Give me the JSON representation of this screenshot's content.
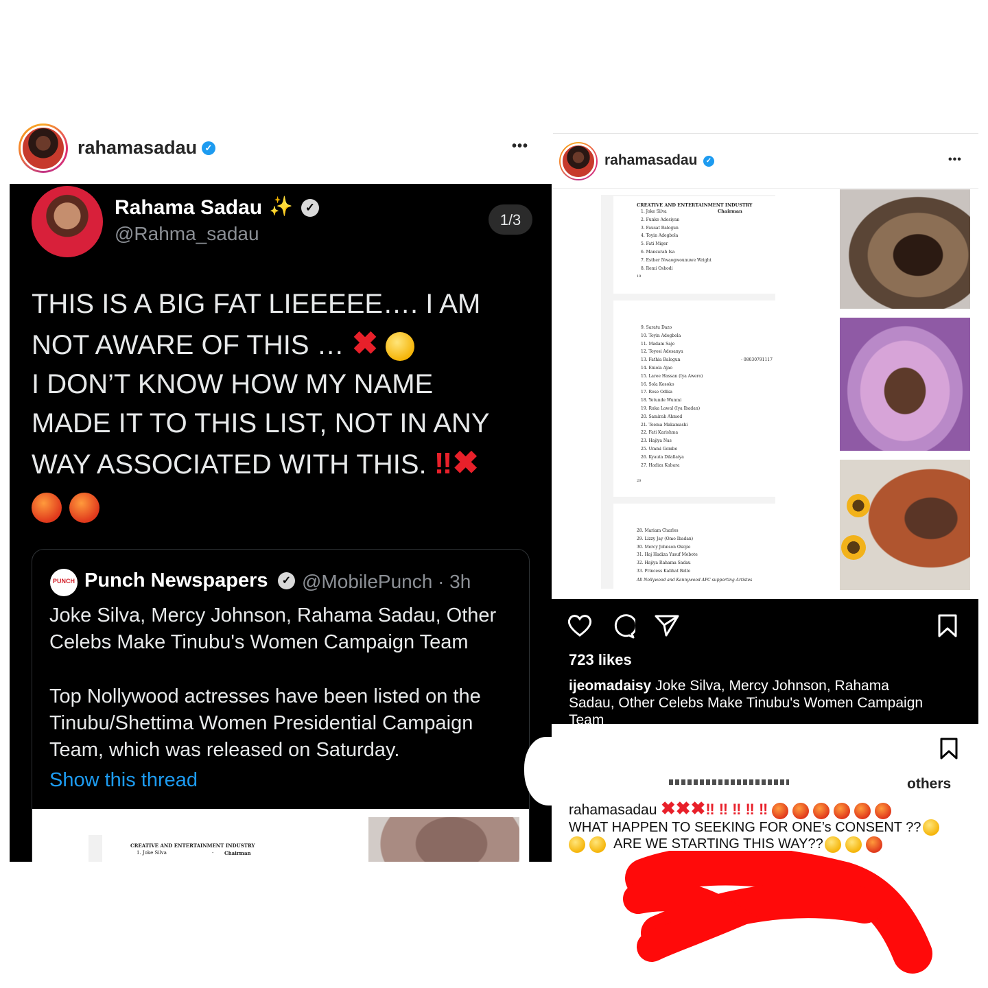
{
  "left_post": {
    "username": "rahamasadau",
    "more": "•••",
    "tweet": {
      "name": "Rahama Sadau",
      "sparkle": "✨",
      "handle": "@Rahma_sadau",
      "counter": "1/3",
      "body_lines": [
        "THIS IS A BIG FAT LIEEEEE…. I AM",
        "NOT AWARE OF THIS …",
        "I DON’T KNOW HOW MY NAME",
        "MADE IT TO THIS LIST, NOT IN ANY",
        "WAY ASSOCIATED WITH THIS."
      ],
      "marks": "‼",
      "x": "✖",
      "quoted": {
        "logo": "PUNCH",
        "name": "Punch Newspapers",
        "handle": "@MobilePunch · 3h",
        "headline_1": "Joke Silva, Mercy Johnson, Rahama Sadau, Other",
        "headline_2": "Celebs Make Tinubu's Women Campaign Team",
        "summary_1": "Top Nollywood actresses have been listed on the",
        "summary_2": "Tinubu/Shettima Women Presidential Campaign",
        "summary_3": "Team, which was released on Saturday.",
        "link": "Show this thread",
        "doc_title": "CREATIVE AND ENTERTAINMENT INDUSTRY",
        "doc_row1": "1.  Joke Silva",
        "doc_dash": "-",
        "doc_role": "Chairman"
      }
    }
  },
  "right_post": {
    "username": "rahamasadau",
    "more": "•••",
    "doc": {
      "title": "CREATIVE AND ENTERTAINMENT INDUSTRY",
      "chair_role": "Chairman",
      "page1": [
        "1.  Joke Silva",
        "2.  Funke Adesiyan",
        "3.  Fausat Balogun",
        "4.  Toyin Adegbola",
        "5.  Fati Miger",
        "6.  Mansurah Isa",
        "7.  Esther Nwaogwounuwe Wright",
        "8.  Remi Oshodi"
      ],
      "page1_num": "19",
      "page2": [
        "9.  Saratu Dazo",
        "10. Toyin Adegbola",
        "11. Madam Saje",
        "12. Toyosi Adesanya",
        "13. Fathia Balogun",
        "14. Eniola Ajao",
        "15. Laree Hassan (Iya Awero)",
        "16. Sola Kosoko",
        "17. Rose Odika",
        "18. Yetunde Wunmi",
        "19. Ruka Lawal (Iya Ibadan)",
        "20. Samirah Ahmed",
        "21. Teema Makamashi",
        "22. Fati Karishma",
        "23. Hajiya Nas",
        "25. Ummi Gombe",
        "26. Kyauta Dilallaiya",
        "27. Hadiza Kabara"
      ],
      "phone": "- 08030791117",
      "page2_num": "20",
      "page3": [
        "28. Mariam Charles",
        "29. Lizzy Jay (Omo Ibadan)",
        "30. Mercy Johnson Okojie",
        "31. Haj Hadiza Yusuf Mobote",
        "32. Hajiya Rahama Sadau",
        "33. Princess Kalihat Bello"
      ],
      "footer": "All Nollywood and Kannywood APC supporting Artistes"
    },
    "likes": "723 likes",
    "caption_user": "ijeomadaisy",
    "caption_1": "Joke Silva, Mercy Johnson, Rahama",
    "caption_2": "Sadau, Other Celebs Make Tinubu's Women Campaign",
    "caption_3": "Team",
    "others": "others",
    "comment_user": "rahamasadau",
    "comment_marks": "‼ ‼ ‼ ‼ ‼",
    "comment_line2": "WHAT HAPPEN TO SEEKING FOR ONE’s CONSENT ??",
    "comment_line3": "ARE WE STARTING THIS WAY??"
  },
  "colors": {
    "verified": "#1d9bf0",
    "link": "#1d9bf0",
    "scribble": "#ff0a0a",
    "angry": "#e0391c"
  }
}
